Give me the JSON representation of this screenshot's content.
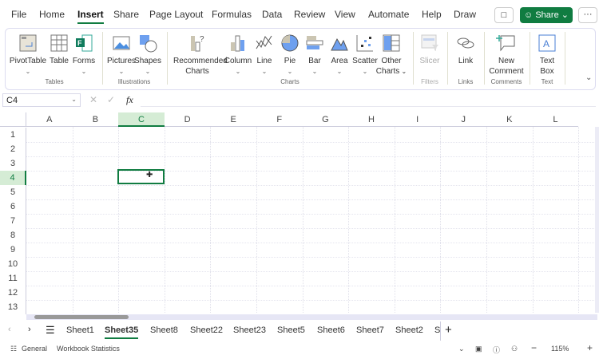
{
  "menu": [
    "File",
    "Home",
    "Insert",
    "Share",
    "Page Layout",
    "Formulas",
    "Data",
    "Review",
    "View",
    "Automate",
    "Help",
    "Draw"
  ],
  "share_label": "Share",
  "ribbon": {
    "items": [
      {
        "label": "PivotTable",
        "icon": "pivottable-icon"
      },
      {
        "label": "Table",
        "icon": "table-icon"
      },
      {
        "label": "Forms",
        "icon": "forms-icon"
      },
      {
        "label": "Pictures",
        "icon": "pictures-icon"
      },
      {
        "label": "Shapes",
        "icon": "shapes-icon"
      },
      {
        "label": "Recommended",
        "label2": "Charts",
        "icon": "recommended-charts-icon"
      },
      {
        "label": "Column",
        "icon": "column-chart-icon"
      },
      {
        "label": "Line",
        "icon": "line-chart-icon"
      },
      {
        "label": "Pie",
        "icon": "pie-chart-icon"
      },
      {
        "label": "Bar",
        "icon": "bar-chart-icon"
      },
      {
        "label": "Area",
        "icon": "area-chart-icon"
      },
      {
        "label": "Scatter",
        "icon": "scatter-chart-icon"
      },
      {
        "label": "Other",
        "label2": "Charts",
        "icon": "other-charts-icon"
      },
      {
        "label": "Slicer",
        "icon": "slicer-icon"
      },
      {
        "label": "Link",
        "icon": "link-icon"
      },
      {
        "label": "New",
        "label2": "Comment",
        "icon": "new-comment-icon"
      },
      {
        "label": "Text",
        "label2": "Box",
        "icon": "text-box-icon"
      }
    ],
    "groups": [
      "Tables",
      "Illustrations",
      "Charts",
      "Filters",
      "Links",
      "Comments",
      "Text"
    ]
  },
  "name_box": "C4",
  "fx": "fx",
  "columns": [
    "A",
    "B",
    "C",
    "D",
    "E",
    "F",
    "G",
    "H",
    "I",
    "J",
    "K",
    "L"
  ],
  "rows": [
    "1",
    "2",
    "3",
    "4",
    "5",
    "6",
    "7",
    "8",
    "9",
    "10",
    "11",
    "12",
    "13"
  ],
  "sheets": [
    "Sheet1",
    "Sheet35",
    "Sheet8",
    "Sheet22",
    "Sheet23",
    "Sheet5",
    "Sheet6",
    "Sheet7",
    "Sheet2",
    "S"
  ],
  "active_sheet": "Sheet35",
  "status": {
    "general": "General",
    "stats": "Workbook Statistics",
    "zoom": "115%"
  },
  "colors": {
    "accent": "#107c41"
  }
}
